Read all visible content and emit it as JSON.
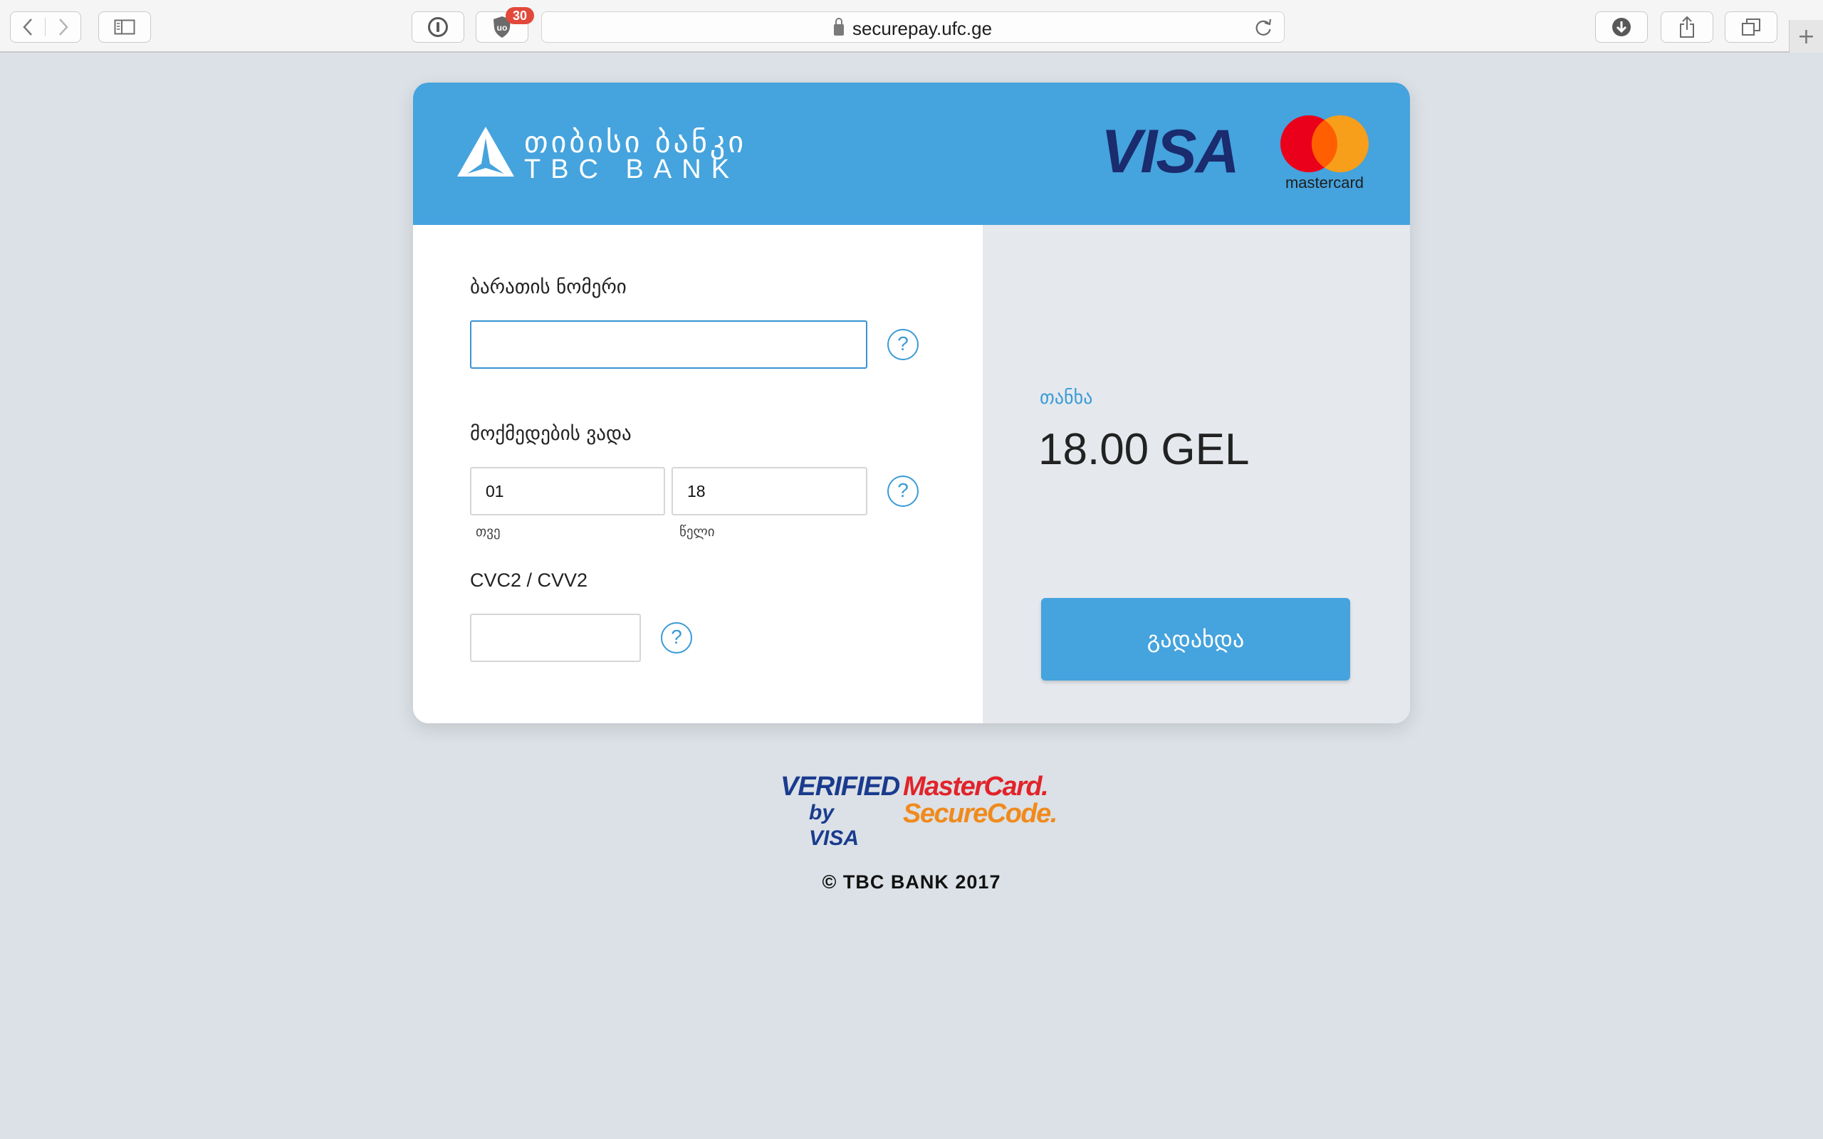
{
  "browser": {
    "url": "securepay.ufc.ge",
    "extension_badge": "30",
    "icons": [
      "back-icon",
      "forward-icon",
      "sidebar-icon",
      "info-icon",
      "ublock-icon",
      "lock-icon",
      "reload-icon",
      "download-icon",
      "share-icon",
      "tabs-icon",
      "plus-icon"
    ]
  },
  "header": {
    "logo_geo": "თიბისი ბანკი",
    "logo_en": "TBC BANK",
    "visa_label": "VISA",
    "mastercard_label": "mastercard"
  },
  "form": {
    "card_number_label": "ბარათის ნომერი",
    "card_number_value": "",
    "expiry_label": "მოქმედების ვადა",
    "month_value": "01",
    "year_value": "18",
    "month_label": "თვე",
    "year_label": "წელი",
    "cvc_label": "CVC2 / CVV2",
    "cvc_value": "",
    "help_symbol": "?"
  },
  "summary": {
    "amount_label": "თანხა",
    "amount_value": "18.00 GEL",
    "pay_button": "გადახდა"
  },
  "footer": {
    "vbv_line1": "VERIFIED",
    "vbv_line2": "by VISA",
    "mcsc_line1": "MasterCard.",
    "mcsc_line2": "SecureCode.",
    "copyright": "© TBC BANK 2017"
  },
  "colors": {
    "brand_blue": "#45a3dd",
    "page_bg": "#dbe1e6",
    "summary_bg": "#e5e9ee",
    "visa_navy": "#1a2b6e",
    "mc_red": "#eb001b",
    "mc_orange": "#f79e1b",
    "badge_red": "#e2493b"
  }
}
